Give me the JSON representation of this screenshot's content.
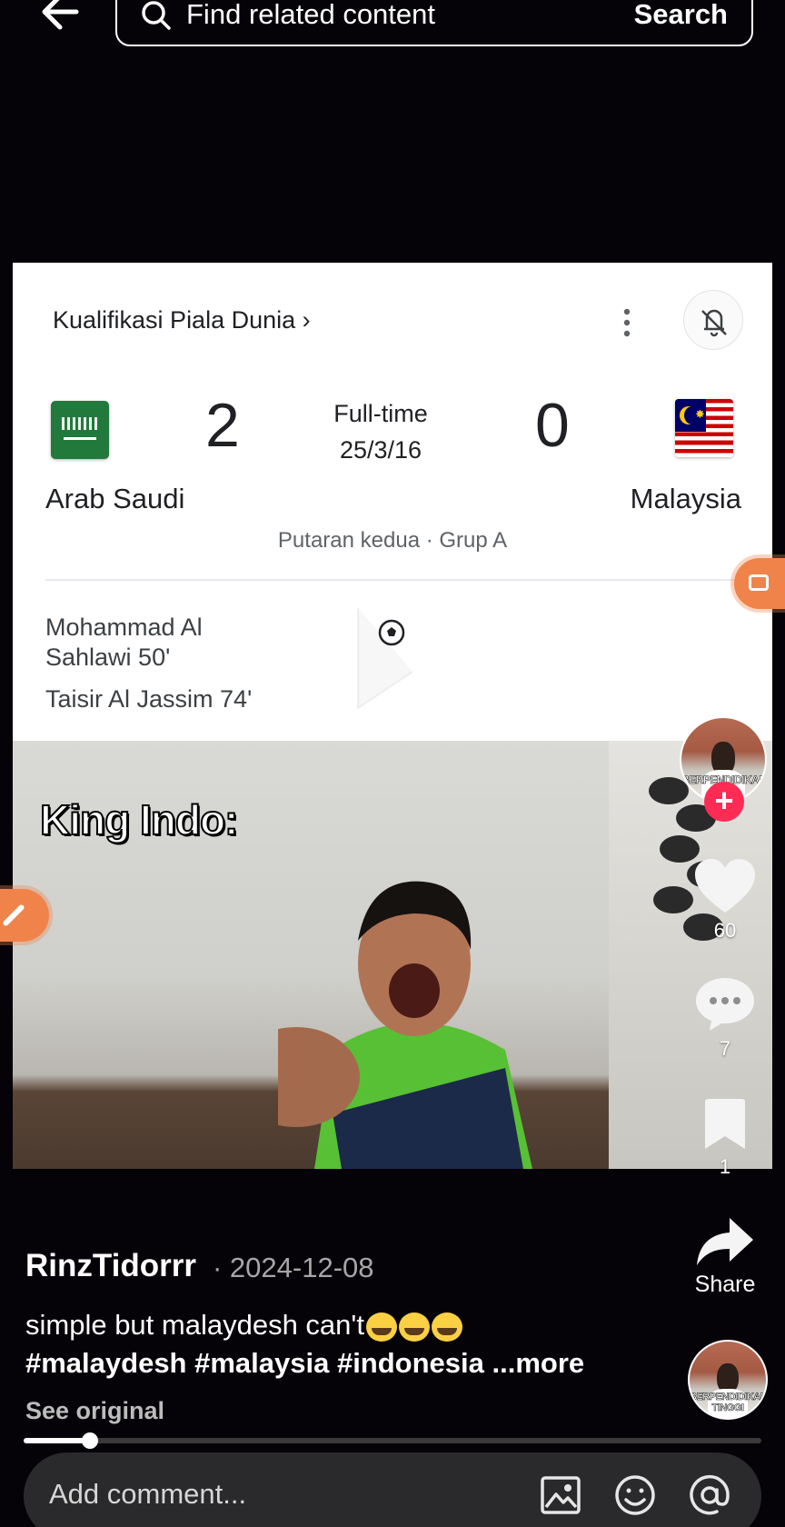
{
  "search": {
    "placeholder": "Find related content",
    "button_label": "Search"
  },
  "match_card": {
    "competition": "Kualifikasi Piala Dunia ›",
    "home_team": "Arab Saudi",
    "away_team": "Malaysia",
    "home_score": "2",
    "away_score": "0",
    "status_line1": "Full-time",
    "status_line2": "25/3/16",
    "round": "Putaran kedua · Grup A",
    "scorer1": "Mohammad Al Sahlawi 50'",
    "scorer2": "Taisir Al Jassim 74'"
  },
  "video_caption": "King Indo:",
  "rail": {
    "avatar_text": "BERPENDIDIKAN",
    "likes": "60",
    "comments": "7",
    "bookmarks": "1",
    "share_label": "Share",
    "music_avatar_text": "BERPENDIDIKAN TINGGI"
  },
  "post": {
    "author": "RinzTidorrr",
    "date": "· 2024-12-08",
    "description": "simple but malaydesh can't",
    "hashtags": "#malaydesh #malaysia #indonesia",
    "more": "...more",
    "see_original": "See original",
    "progress_fraction": 0.09
  },
  "comment": {
    "placeholder": "Add comment..."
  },
  "colors": {
    "like_red": "#fe2c55",
    "accent_orange": "#f0834a"
  },
  "icons": {
    "back": "arrow-left",
    "search": "magnifier",
    "like": "heart",
    "comment": "speech-bubble",
    "bookmark": "bookmark",
    "share": "share-arrow",
    "image": "image",
    "emoji": "smiley",
    "mention": "at-sign"
  }
}
